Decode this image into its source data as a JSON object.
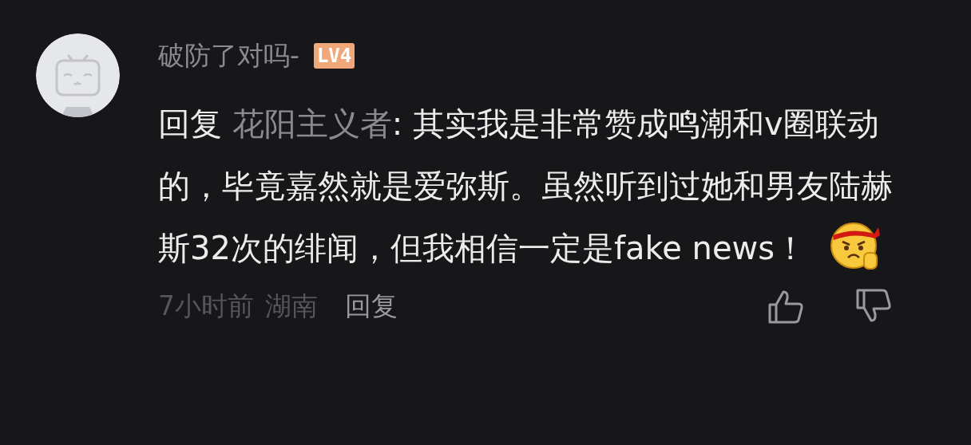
{
  "comment": {
    "username": "破防了对吗-",
    "level_badge": "LV4",
    "reply_prefix": "回复",
    "reply_to": "花阳主义者",
    "body": ": 其实我是非常赞成鸣潮和v圈联动的，毕竟嘉然就是爱弥斯。虽然听到过她和男友陆赫斯32次的绯闻，但我相信一定是fake news！",
    "time": "7小时前",
    "location": "湖南",
    "reply_button": "回复",
    "liked": false,
    "disliked": false
  }
}
